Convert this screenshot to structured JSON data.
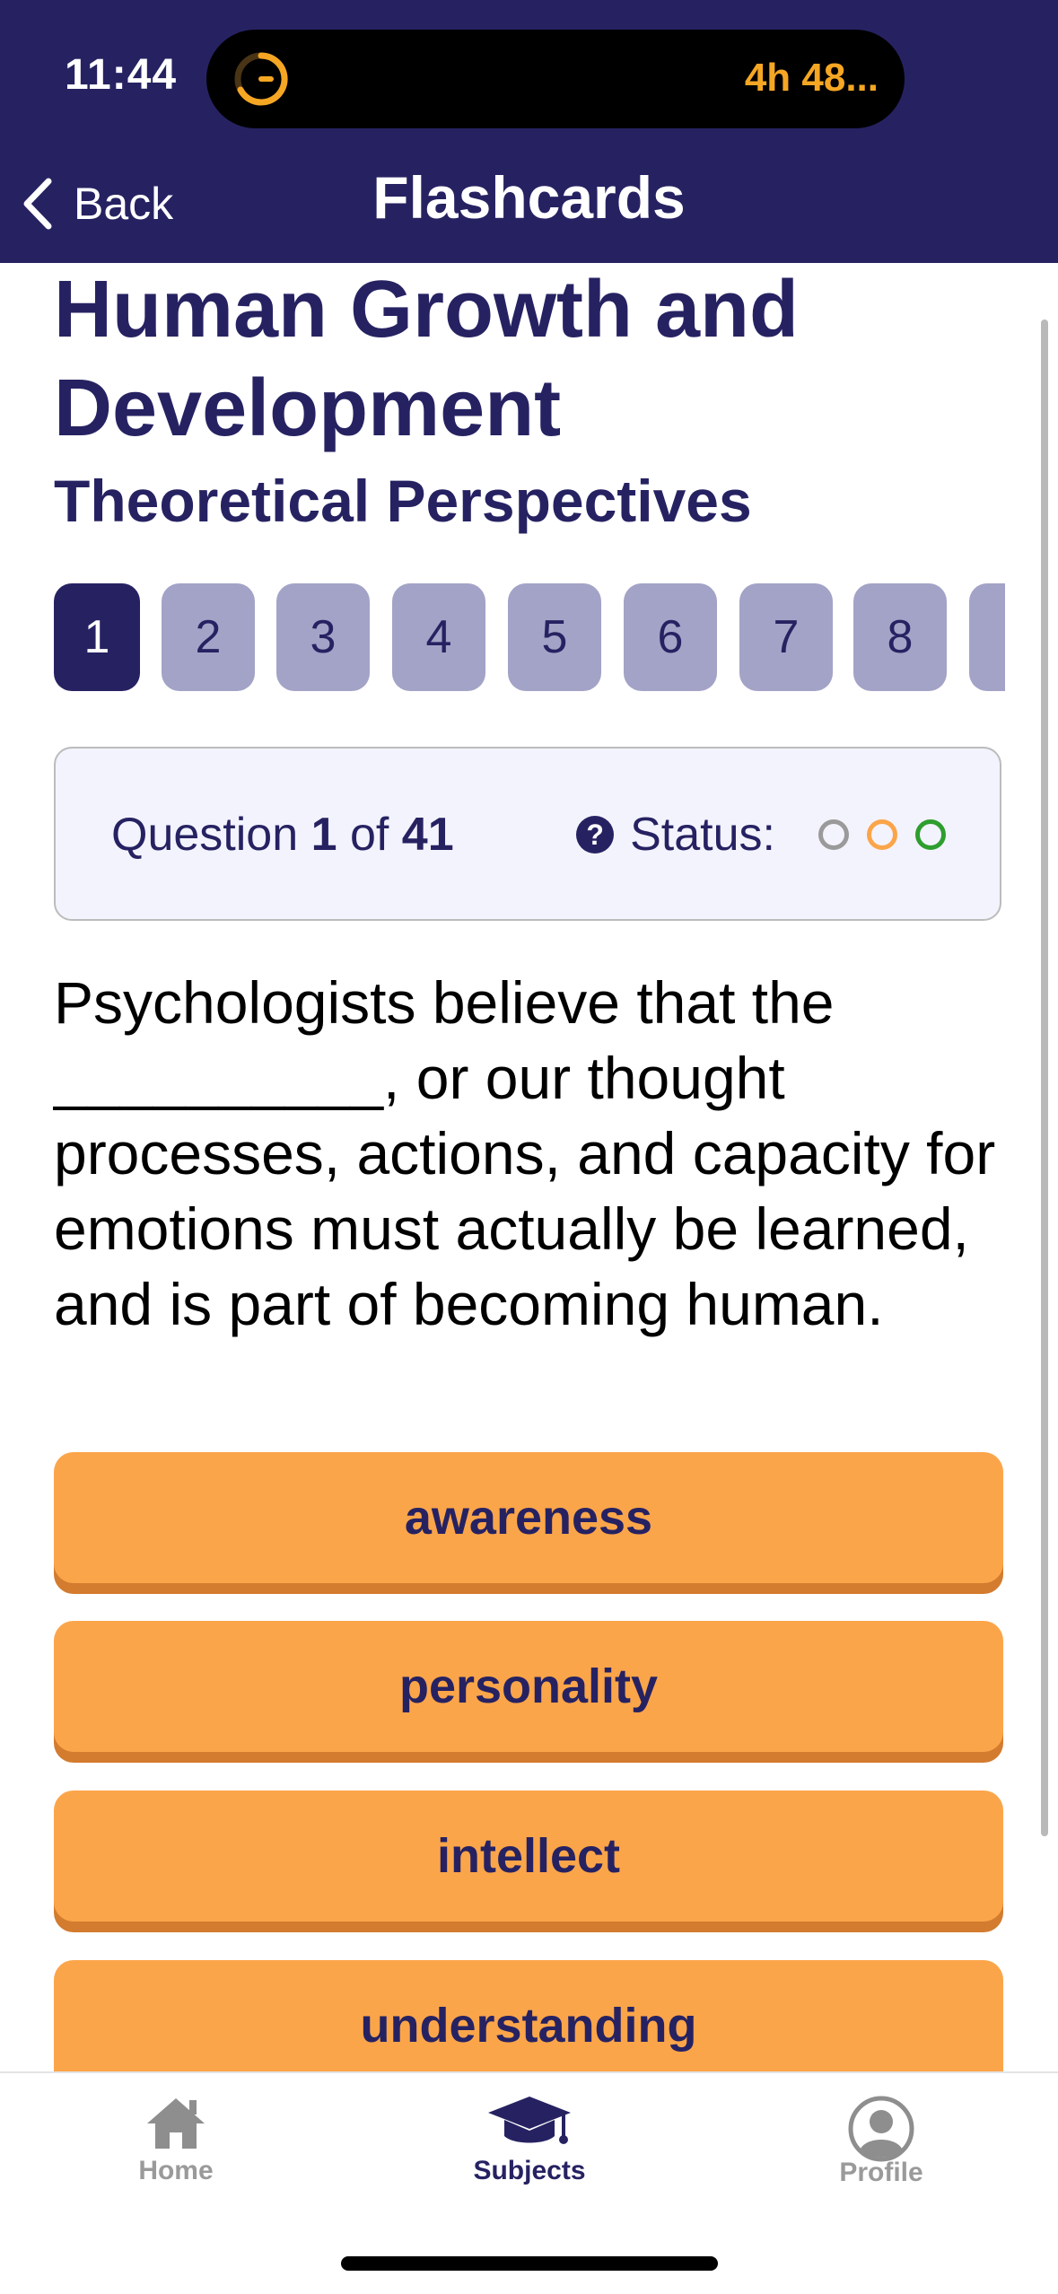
{
  "status_bar": {
    "time": "11:44",
    "live_activity_timer": "4h 48..."
  },
  "nav": {
    "back_label": "Back",
    "title": "Flashcards"
  },
  "page": {
    "title": "Human Growth and Development",
    "subtitle": "Theoretical Perspectives"
  },
  "question_tabs": [
    "1",
    "2",
    "3",
    "4",
    "5",
    "6",
    "7",
    "8"
  ],
  "active_tab": "1",
  "info": {
    "question_prefix": "Question",
    "current": "1",
    "of_word": "of",
    "total": "41",
    "status_label": "Status:",
    "status_dot_colors": [
      "#9a9a9a",
      "#fba54a",
      "#2e9e2e"
    ]
  },
  "question_text": "Psychologists believe that the __________, or our thought processes, actions, and capacity for emotions must actually be learned, and is part of becoming human.",
  "answers": [
    "awareness",
    "personality",
    "intellect",
    "understanding"
  ],
  "tabbar": {
    "home": "Home",
    "subjects": "Subjects",
    "profile": "Profile"
  },
  "colors": {
    "brand_navy": "#262262",
    "answer_orange": "#fba54a",
    "inactive_tab": "#a3a3c7",
    "timer_orange": "#f5a623"
  }
}
